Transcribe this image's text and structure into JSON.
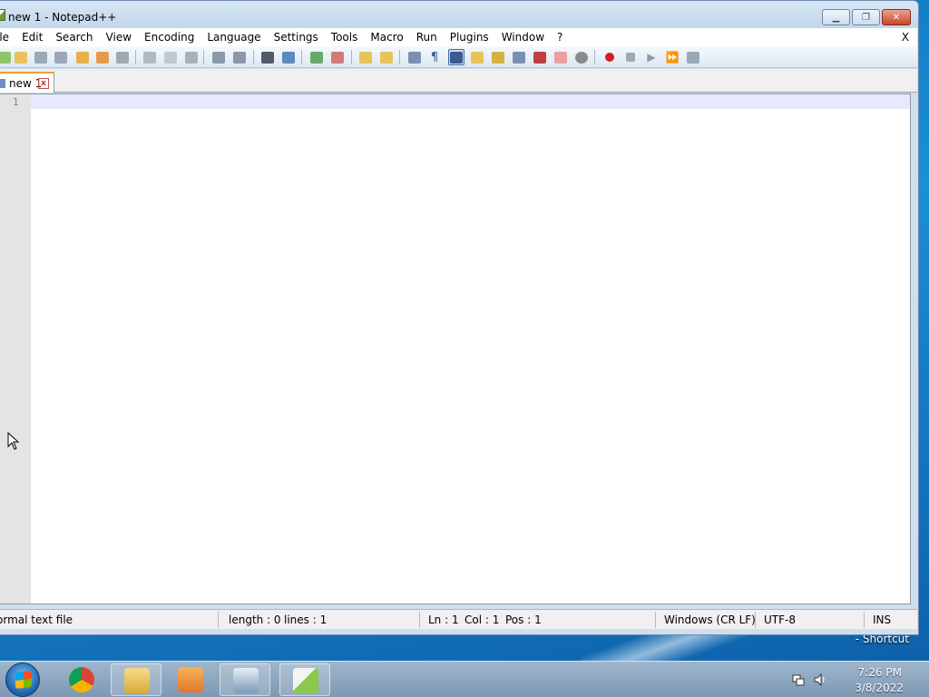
{
  "window": {
    "title": "new 1 - Notepad++"
  },
  "menubar": {
    "items": [
      "ile",
      "Edit",
      "Search",
      "View",
      "Encoding",
      "Language",
      "Settings",
      "Tools",
      "Macro",
      "Run",
      "Plugins",
      "Window",
      "?"
    ],
    "close_label": "X"
  },
  "tabs": [
    {
      "label": "new 1",
      "close": "x"
    }
  ],
  "editor": {
    "line_numbers": [
      "1"
    ],
    "content": ""
  },
  "statusbar": {
    "file_type": "ormal text file",
    "length": "length : 0",
    "lines": "lines : 1",
    "ln": "Ln : 1",
    "col": "Col : 1",
    "pos": "Pos : 1",
    "eol": "Windows (CR LF)",
    "encoding": "UTF-8",
    "mode": "INS"
  },
  "desktop": {
    "shortcut_label": "- Shortcut"
  },
  "taskbar": {
    "time": "7:26 PM",
    "date": "3/8/2022",
    "apps": [
      "chrome",
      "file-explorer",
      "media-player",
      "app-window",
      "notepad-plus-plus"
    ]
  },
  "colors": {
    "accent": "#3a6fb0",
    "tab_highlight": "#f0a030",
    "current_line": "#e8e8ff"
  }
}
